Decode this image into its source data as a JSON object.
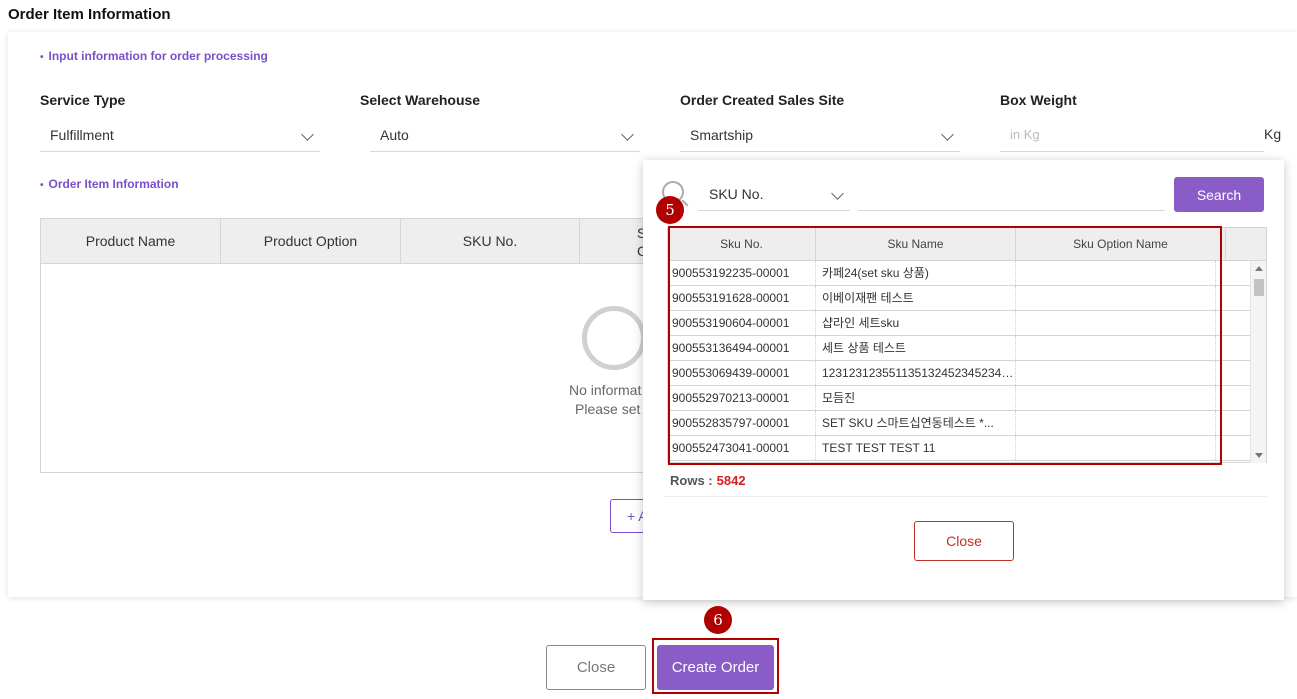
{
  "page_title": "Order Item Information",
  "notes": {
    "input_info": "Input information for order processing",
    "order_item_info": "Order Item Information"
  },
  "form": {
    "service_type": {
      "label": "Service Type",
      "value": "Fulfillment"
    },
    "warehouse": {
      "label": "Select Warehouse",
      "value": "Auto"
    },
    "sales_site": {
      "label": "Order Created Sales Site",
      "value": "Smartship"
    },
    "box_weight": {
      "label": "Box Weight",
      "placeholder": "in Kg",
      "unit": "Kg"
    }
  },
  "item_grid": {
    "columns": [
      "Product Name",
      "Product Option",
      "SKU No.",
      "S",
      "C"
    ],
    "empty_line1": "No informat",
    "empty_line2": "Please set a",
    "add_button": "+ A"
  },
  "popup": {
    "search_field": "SKU No.",
    "search_button": "Search",
    "columns": [
      "Sku No.",
      "Sku Name",
      "Sku Option Name"
    ],
    "rows": [
      {
        "sku_no": "900553192235-00001",
        "sku_name": "카페24(set sku 상품)",
        "option": ""
      },
      {
        "sku_no": "900553191628-00001",
        "sku_name": "이베이재팬 테스트",
        "option": ""
      },
      {
        "sku_no": "900553190604-00001",
        "sku_name": "샵라인 세트sku",
        "option": ""
      },
      {
        "sku_no": "900553136494-00001",
        "sku_name": "세트 상품 테스트",
        "option": ""
      },
      {
        "sku_no": "900553069439-00001",
        "sku_name": "12312312355113513245234523452...",
        "option": ""
      },
      {
        "sku_no": "900552970213-00001",
        "sku_name": "모듬진",
        "option": ""
      },
      {
        "sku_no": "900552835797-00001",
        "sku_name": "SET SKU 스마트십연동테스트 *...",
        "option": ""
      },
      {
        "sku_no": "900552473041-00001",
        "sku_name": "TEST TEST TEST 11",
        "option": ""
      }
    ],
    "rows_label": "Rows :",
    "rows_count": "5842",
    "close_button": "Close"
  },
  "markers": {
    "step5": "5",
    "step6": "6"
  },
  "footer": {
    "close_button": "Close",
    "create_button": "Create Order"
  },
  "colors": {
    "accent": "#8a5cc8",
    "highlight": "#b00000",
    "count": "#d32020"
  }
}
